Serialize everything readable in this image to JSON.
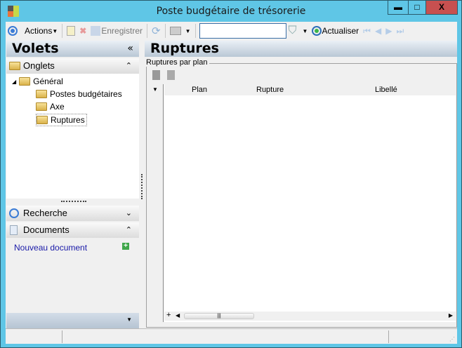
{
  "window": {
    "title": "Poste budgétaire de trésorerie",
    "minimize": "▬",
    "maximize": "□",
    "close": "X"
  },
  "toolbar": {
    "actions": "Actions",
    "save": "Enregistrer",
    "search_value": "",
    "refresh": "Actualiser"
  },
  "left": {
    "title": "Volets",
    "collapse": "«",
    "onglets": {
      "label": "Onglets",
      "tree": {
        "root": "Général",
        "children": [
          "Postes budgétaires",
          "Axe",
          "Ruptures"
        ],
        "selected": "Ruptures"
      }
    },
    "recherche": {
      "label": "Recherche"
    },
    "documents": {
      "label": "Documents",
      "new_doc": "Nouveau document"
    }
  },
  "main": {
    "title": "Ruptures",
    "group_label": "Ruptures par plan",
    "grid": {
      "columns": [
        "Plan",
        "Rupture",
        "Libellé"
      ],
      "rows": []
    }
  }
}
